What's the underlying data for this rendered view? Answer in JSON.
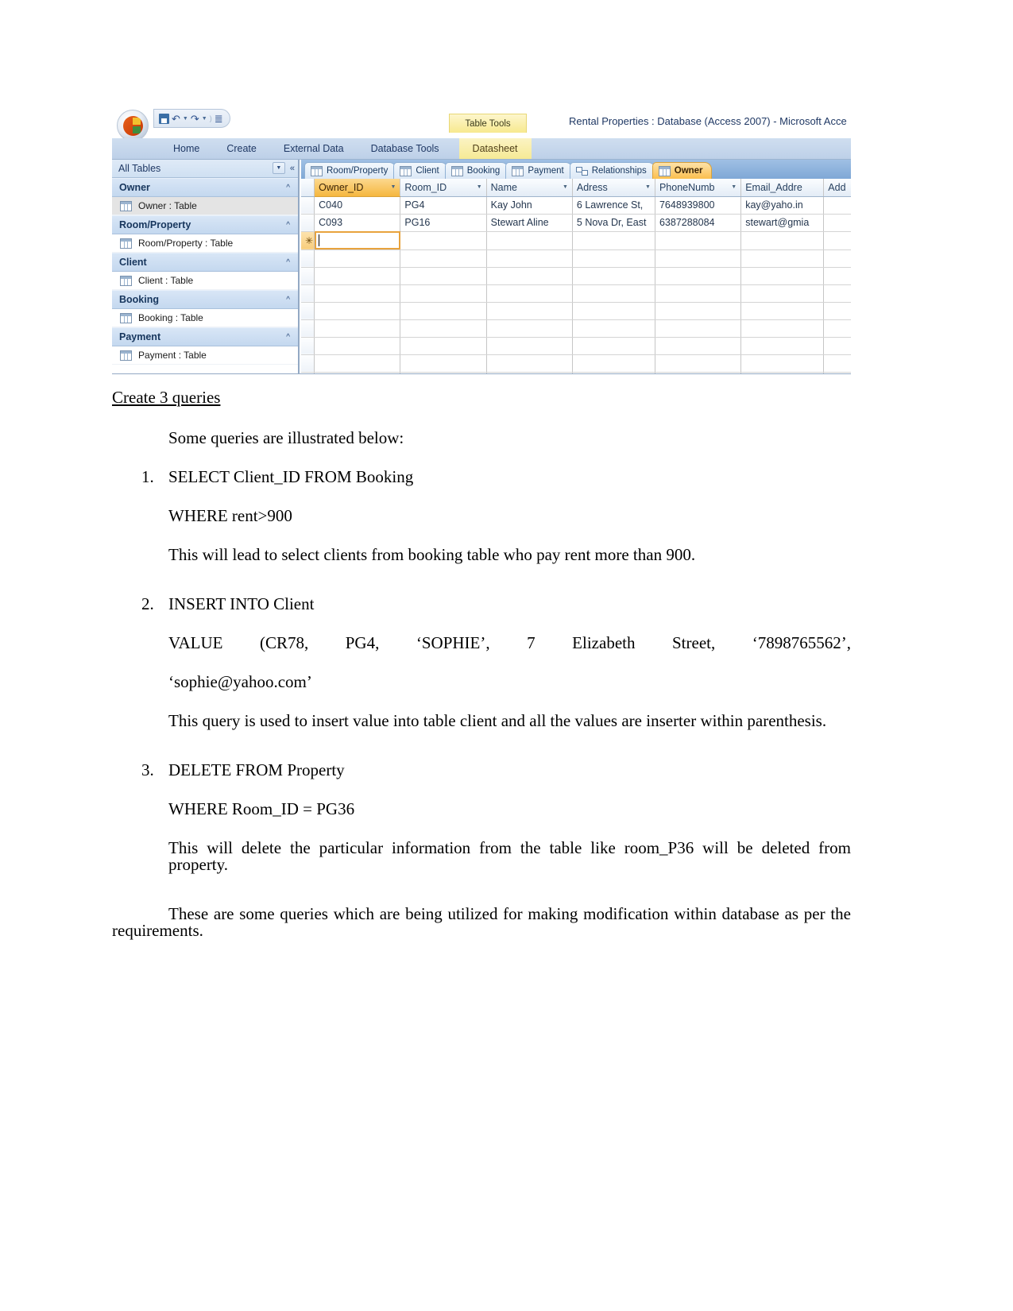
{
  "access": {
    "window_title": "Rental Properties : Database (Access 2007)  -  Microsoft Acce",
    "contextual_tab_group": "Table Tools",
    "quick_access": {
      "save_icon": "save-icon",
      "undo_icon": "undo-icon",
      "redo_icon": "redo-icon",
      "customize_icon": "customize-qat-icon"
    },
    "ribbon_tabs": [
      {
        "label": "Home",
        "contextual": false
      },
      {
        "label": "Create",
        "contextual": false
      },
      {
        "label": "External Data",
        "contextual": false
      },
      {
        "label": "Database Tools",
        "contextual": false
      },
      {
        "label": "Datasheet",
        "contextual": true
      }
    ],
    "nav_pane": {
      "title": "All Tables",
      "groups": [
        {
          "name": "Owner",
          "items": [
            {
              "label": "Owner : Table",
              "selected": true
            }
          ]
        },
        {
          "name": "Room/Property",
          "items": [
            {
              "label": "Room/Property : Table",
              "selected": false
            }
          ]
        },
        {
          "name": "Client",
          "items": [
            {
              "label": "Client : Table",
              "selected": false
            }
          ]
        },
        {
          "name": "Booking",
          "items": [
            {
              "label": "Booking : Table",
              "selected": false
            }
          ]
        },
        {
          "name": "Payment",
          "items": [
            {
              "label": "Payment : Table",
              "selected": false
            }
          ]
        }
      ]
    },
    "document_tabs": [
      {
        "label": "Room/Property",
        "icon": "table-icon",
        "active": false
      },
      {
        "label": "Client",
        "icon": "table-icon",
        "active": false
      },
      {
        "label": "Booking",
        "icon": "table-icon",
        "active": false
      },
      {
        "label": "Payment",
        "icon": "table-icon",
        "active": false
      },
      {
        "label": "Relationships",
        "icon": "relationships-icon",
        "active": false
      },
      {
        "label": "Owner",
        "icon": "table-icon",
        "active": true
      }
    ],
    "datasheet": {
      "columns": [
        {
          "label": "Owner_ID",
          "highlighted": true
        },
        {
          "label": "Room_ID",
          "highlighted": false
        },
        {
          "label": "Name",
          "highlighted": false
        },
        {
          "label": "Adress",
          "highlighted": false
        },
        {
          "label": "PhoneNumb",
          "highlighted": false
        },
        {
          "label": "Email_Addre",
          "highlighted": false
        },
        {
          "label": "Add",
          "highlighted": false
        }
      ],
      "rows": [
        [
          "C040",
          "PG4",
          "Kay John",
          "6 Lawrence St,",
          "7648939800",
          "kay@yaho.in",
          ""
        ],
        [
          "C093",
          "PG16",
          "Stewart Aline",
          "5 Nova Dr, East",
          "6387288084",
          "stewart@gmia",
          ""
        ]
      ],
      "new_record_marker": "✳",
      "new_record_value": ""
    },
    "colors": {
      "accent_orange": "#f5b73f",
      "tab_blue": "#7fa8d6",
      "nav_group": "#c4d8ef"
    }
  },
  "document": {
    "heading": "Create 3 queries",
    "intro": "Some queries are illustrated below:",
    "queries": [
      {
        "number": "1.",
        "lines": [
          "SELECT Client_ID FROM Booking",
          "WHERE rent>900"
        ],
        "explanation": "This will lead to select clients from booking table who pay rent more than 900."
      },
      {
        "number": "2.",
        "lines": [
          "INSERT INTO Client",
          "VALUE (CR78, PG4, ‘SOPHIE’, 7 Elizabeth Street, ‘7898765562’,",
          "‘sophie@yahoo.com’"
        ],
        "explanation": "This query is used to insert value into table client and all the values are inserter within parenthesis."
      },
      {
        "number": "3.",
        "lines": [
          "DELETE FROM Property",
          "WHERE Room_ID = PG36"
        ],
        "explanation": "This will delete the particular information from the table like room_P36 will be deleted from property."
      }
    ],
    "closing": "These are some queries which are being utilized for making modification within database as per the requirements."
  }
}
